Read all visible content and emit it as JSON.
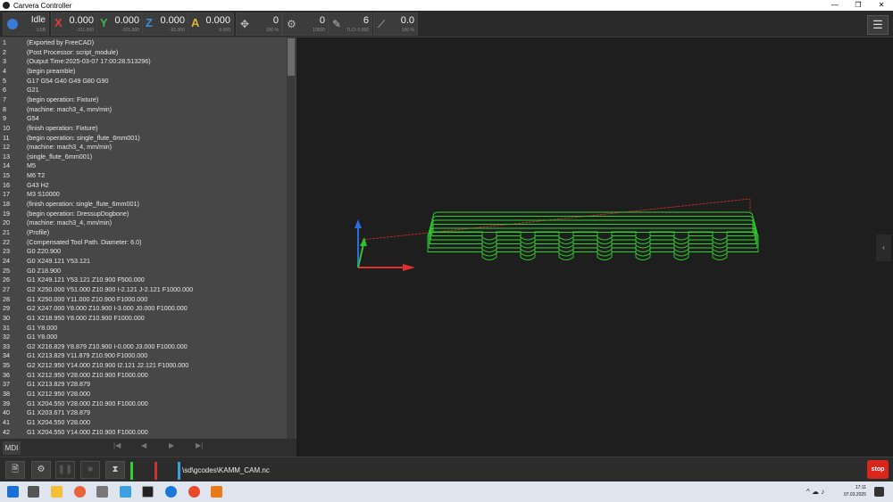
{
  "window": {
    "title": "Carvera Controller",
    "controls": [
      "—",
      "❐",
      "✕"
    ]
  },
  "status": {
    "state": "Idle",
    "connection": "USB"
  },
  "dro": {
    "x": {
      "label": "X",
      "value": "0.000",
      "machine": "-311.000",
      "color": "#e23b3b"
    },
    "y": {
      "label": "Y",
      "value": "0.000",
      "machine": "-221.000",
      "color": "#3bb54a"
    },
    "z": {
      "label": "Z",
      "value": "0.000",
      "machine": "-61.000",
      "color": "#3b8fe2"
    },
    "a": {
      "label": "A",
      "value": "0.000",
      "machine": "0.000",
      "color": "#e2b13b"
    },
    "feed": {
      "icon": "move-arrows-icon",
      "value": "0",
      "sub": "100 %"
    },
    "spindle": {
      "icon": "spindle-icon",
      "value": "0",
      "sub": "10000"
    },
    "tool": {
      "icon": "tool-icon",
      "value": "6",
      "sub": "TLO: 0.000"
    },
    "laser": {
      "icon": "laser-icon",
      "value": "0.0",
      "sub": "100 %"
    }
  },
  "gcode": [
    {
      "n": "1",
      "t": "(Exported by FreeCAD)"
    },
    {
      "n": "2",
      "t": "(Post Processor: script_module)"
    },
    {
      "n": "3",
      "t": "(Output Time:2025-03-07 17:00:28.513296)"
    },
    {
      "n": "4",
      "t": "(begin preamble)"
    },
    {
      "n": "5",
      "t": "G17 G54 G40 G49 G80 G90"
    },
    {
      "n": "6",
      "t": "G21"
    },
    {
      "n": "7",
      "t": "(begin operation: Fixture)"
    },
    {
      "n": "8",
      "t": "(machine: mach3_4, mm/min)"
    },
    {
      "n": "9",
      "t": "G54"
    },
    {
      "n": "10",
      "t": "(finish operation: Fixture)"
    },
    {
      "n": "11",
      "t": "(begin operation: single_flute_6mm001)"
    },
    {
      "n": "12",
      "t": "(machine: mach3_4, mm/min)"
    },
    {
      "n": "13",
      "t": "(single_flute_6mm001)"
    },
    {
      "n": "14",
      "t": "M5"
    },
    {
      "n": "15",
      "t": "M6 T2"
    },
    {
      "n": "16",
      "t": "G43 H2"
    },
    {
      "n": "17",
      "t": "M3 S10000"
    },
    {
      "n": "18",
      "t": "(finish operation: single_flute_6mm001)"
    },
    {
      "n": "19",
      "t": "(begin operation: DressupDogbone)"
    },
    {
      "n": "20",
      "t": "(machine: mach3_4, mm/min)"
    },
    {
      "n": "21",
      "t": "(Profile)"
    },
    {
      "n": "22",
      "t": "(Compensated Tool Path. Diameter: 6.0)"
    },
    {
      "n": "23",
      "t": "G0 Z20.900"
    },
    {
      "n": "24",
      "t": "G0 X249.121 Y53.121"
    },
    {
      "n": "25",
      "t": "G0 Z18.900"
    },
    {
      "n": "26",
      "t": "G1 X249.121 Y53.121 Z10.900 F500.000"
    },
    {
      "n": "27",
      "t": "G2 X250.000 Y51.000 Z10.900 I-2.121 J-2.121 F1000.000"
    },
    {
      "n": "28",
      "t": "G1 X250.000 Y11.000 Z10.900 F1000.000"
    },
    {
      "n": "29",
      "t": "G2 X247.000 Y8.000 Z10.900 I-3.000 J0.000 F1000.000"
    },
    {
      "n": "30",
      "t": "G1 X218.950 Y8.000 Z10.900 F1000.000"
    },
    {
      "n": "31",
      "t": "G1 Y8.000"
    },
    {
      "n": "32",
      "t": "G1 Y8.000"
    },
    {
      "n": "33",
      "t": "G2 X216.829 Y8.879 Z10.900 I-0.000 J3.000 F1000.000"
    },
    {
      "n": "34",
      "t": "G1 X213.829 Y11.879 Z10.900 F1000.000"
    },
    {
      "n": "35",
      "t": "G2 X212.950 Y14.000 Z10.900 I2.121 J2.121 F1000.000"
    },
    {
      "n": "36",
      "t": "G1 X212.950 Y28.000 Z10.900 F1000.000"
    },
    {
      "n": "37",
      "t": "G1 X213.829 Y28.879"
    },
    {
      "n": "38",
      "t": "G1 X212.950 Y28.000"
    },
    {
      "n": "39",
      "t": "G1 X204.550 Y28.000 Z10.900 F1000.000"
    },
    {
      "n": "40",
      "t": "G1 X203.671 Y28.879"
    },
    {
      "n": "41",
      "t": "G1 X204.550 Y28.000"
    },
    {
      "n": "42",
      "t": "G1 X204.550 Y14.000 Z10.900 F1000.000"
    }
  ],
  "gcode_nav": {
    "mdi": "MDI",
    "first": "|◀",
    "prev": "◀",
    "next": "▶",
    "last": "▶|"
  },
  "bottom": {
    "file_path": "\\sd\\gcodes\\KAMM_CAM.nc",
    "stop": "stop"
  },
  "colors": {
    "toolpath": "#2fd12f",
    "rapid": "#d03030",
    "panel": "#474747",
    "viewport": "#1e1e1e"
  },
  "taskbar": {
    "time": "17:11",
    "date": "07.03.2025"
  }
}
